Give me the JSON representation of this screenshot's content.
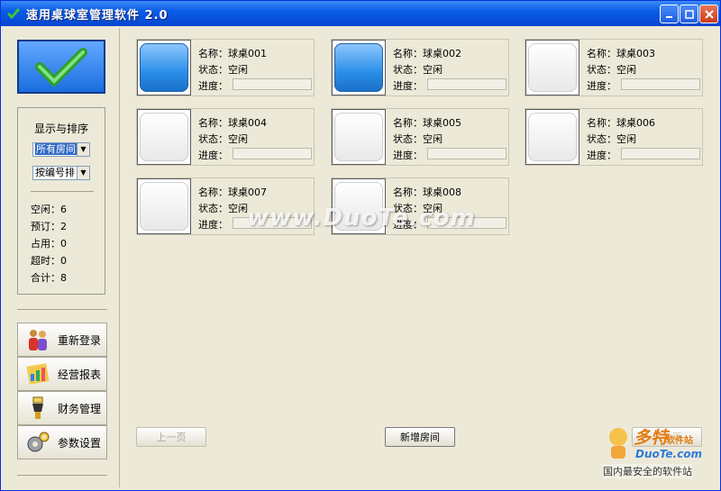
{
  "window": {
    "title": "速用桌球室管理软件 2.0"
  },
  "sidebar": {
    "panel_title": "显示与排序",
    "filter_select": "所有房间",
    "sort_select": "按编号排",
    "stats": [
      "空闲：6",
      "预订：2",
      "占用：0",
      "超时：0",
      "合计：8"
    ],
    "nav": [
      {
        "label": "重新登录",
        "icon": "people-icon"
      },
      {
        "label": "经营报表",
        "icon": "chart-icon"
      },
      {
        "label": "财务管理",
        "icon": "cashier-icon"
      },
      {
        "label": "参数设置",
        "icon": "gear-icon"
      }
    ]
  },
  "labels": {
    "name": "名称：",
    "status": "状态：",
    "progress": "进度："
  },
  "tables": [
    {
      "name": "球桌001",
      "status": "空闲",
      "color": "blue"
    },
    {
      "name": "球桌002",
      "status": "空闲",
      "color": "blue"
    },
    {
      "name": "球桌003",
      "status": "空闲",
      "color": "white"
    },
    {
      "name": "球桌004",
      "status": "空闲",
      "color": "white"
    },
    {
      "name": "球桌005",
      "status": "空闲",
      "color": "white"
    },
    {
      "name": "球桌006",
      "status": "空闲",
      "color": "white"
    },
    {
      "name": "球桌007",
      "status": "空闲",
      "color": "white"
    },
    {
      "name": "球桌008",
      "status": "空闲",
      "color": "white"
    }
  ],
  "footer": {
    "prev_label": "上一页",
    "add_label": "新增房间",
    "next_label": "下一页"
  },
  "watermark": {
    "site": "www.DuoTe.com",
    "brand": "多特",
    "tag": "软件站",
    "url": "DuoTe.com",
    "slogan": "国内最安全的软件站"
  },
  "colors": {
    "accent": "#0a5ce8",
    "blue_table": "#2b8ee8",
    "window_bg": "#ece9d8"
  }
}
